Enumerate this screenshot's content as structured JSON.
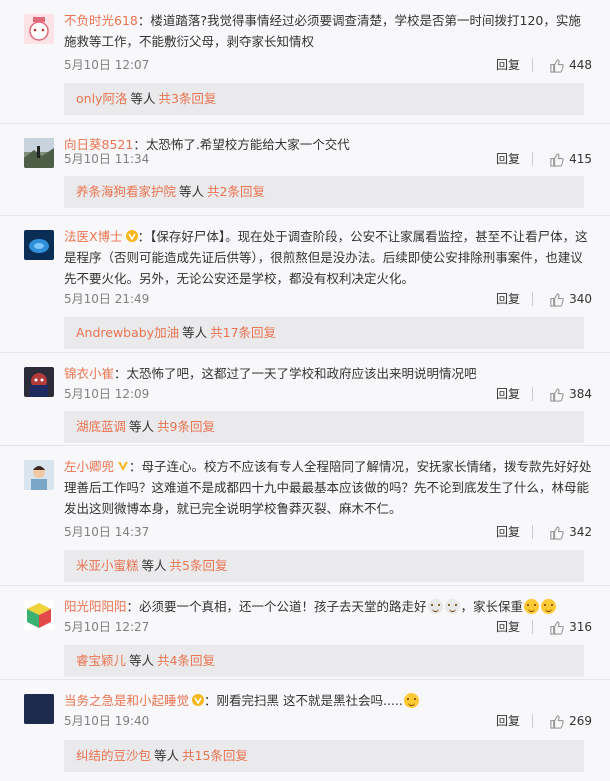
{
  "comments": [
    {
      "user": "不负时光618",
      "badge": false,
      "text": "：楼道踏落?我觉得事情经过必须要调查清楚，学校是否第一时间拨打120，实施施救等工作，不能敷衍父母，剥夺家长知情权",
      "date": "5月10日 12:07",
      "reply_label": "回复",
      "likes": "448",
      "sub": {
        "who": "only阿洛",
        "etc": "等人",
        "more": "共3条回复"
      }
    },
    {
      "user": "向日葵8521",
      "badge": false,
      "text": "：太恐怖了.希望校方能给大家一个交代",
      "date": "5月10日 11:34",
      "reply_label": "回复",
      "likes": "415",
      "sub": {
        "who": "养条海狗看家护院",
        "etc": "等人",
        "more": "共2条回复"
      }
    },
    {
      "user": "法医X博士",
      "badge": true,
      "text": "：【保存好尸体】。现在处于调查阶段，公安不让家属看监控，甚至不让看尸体，这是程序（否则可能造成先证后供等），很煎熬但是没办法。后续即使公安排除刑事案件，也建议先不要火化。另外，无论公安还是学校，都没有权利决定火化。",
      "date": "5月10日 21:49",
      "reply_label": "回复",
      "likes": "340",
      "sub": {
        "who": "Andrewbaby加油",
        "etc": "等人",
        "more": "共17条回复"
      }
    },
    {
      "user": "锦衣小崔",
      "badge": false,
      "text": "：太恐怖了吧，这都过了一天了学校和政府应该出来明说明情况吧",
      "date": "5月10日 12:09",
      "reply_label": "回复",
      "likes": "384",
      "sub": {
        "who": "湖底蓝调",
        "etc": "等人",
        "more": "共9条回复"
      }
    },
    {
      "user": "左小卿兜",
      "badge": true,
      "text": "：母子连心。校方不应该有专人全程陪同了解情况，安抚家长情绪，拨专款先好好处理善后工作吗？这难道不是成都四十九中最最基本应该做的吗？先不论到底发生了什么，林母能发出这则微博本身，就已完全说明学校鲁莽灭裂、麻木不仁。",
      "date": "5月10日 14:37",
      "reply_label": "回复",
      "likes": "342",
      "sub": {
        "who": "米亚小蜜糕",
        "etc": "等人",
        "more": "共5条回复"
      }
    },
    {
      "user": "阳光阳阳阳",
      "badge": false,
      "text": "：必须要一个真相，还一个公道！孩子去天堂的路走好",
      "text2": "，家长保重",
      "date": "5月10日 12:27",
      "reply_label": "回复",
      "likes": "316",
      "sub": {
        "who": "睿宝颖儿",
        "etc": "等人",
        "more": "共4条回复"
      }
    },
    {
      "user": "当务之急是和小起睡觉",
      "badge": true,
      "text": "：刚看完扫黑 这不就是黑社会吗.....",
      "date": "5月10日 19:40",
      "reply_label": "回复",
      "likes": "269",
      "sub": {
        "who": "纠结的豆沙包",
        "etc": "等人",
        "more": "共15条回复"
      }
    }
  ],
  "colors": {
    "username": "#eb7350",
    "subbox_bg": "#eaeaec",
    "badge_gold": "#f6b71c"
  },
  "icons": {
    "like": "thumbs-up-icon",
    "verified": "verified-v-icon"
  }
}
